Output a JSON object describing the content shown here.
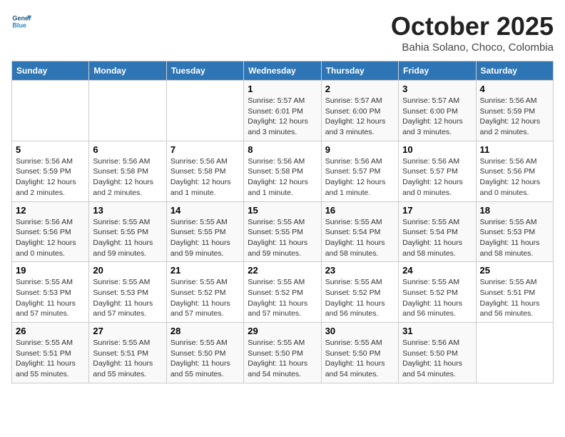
{
  "header": {
    "logo_line1": "General",
    "logo_line2": "Blue",
    "month": "October 2025",
    "location": "Bahia Solano, Choco, Colombia"
  },
  "weekdays": [
    "Sunday",
    "Monday",
    "Tuesday",
    "Wednesday",
    "Thursday",
    "Friday",
    "Saturday"
  ],
  "weeks": [
    [
      {
        "day": "",
        "info": ""
      },
      {
        "day": "",
        "info": ""
      },
      {
        "day": "",
        "info": ""
      },
      {
        "day": "1",
        "info": "Sunrise: 5:57 AM\nSunset: 6:01 PM\nDaylight: 12 hours\nand 3 minutes."
      },
      {
        "day": "2",
        "info": "Sunrise: 5:57 AM\nSunset: 6:00 PM\nDaylight: 12 hours\nand 3 minutes."
      },
      {
        "day": "3",
        "info": "Sunrise: 5:57 AM\nSunset: 6:00 PM\nDaylight: 12 hours\nand 3 minutes."
      },
      {
        "day": "4",
        "info": "Sunrise: 5:56 AM\nSunset: 5:59 PM\nDaylight: 12 hours\nand 2 minutes."
      }
    ],
    [
      {
        "day": "5",
        "info": "Sunrise: 5:56 AM\nSunset: 5:59 PM\nDaylight: 12 hours\nand 2 minutes."
      },
      {
        "day": "6",
        "info": "Sunrise: 5:56 AM\nSunset: 5:58 PM\nDaylight: 12 hours\nand 2 minutes."
      },
      {
        "day": "7",
        "info": "Sunrise: 5:56 AM\nSunset: 5:58 PM\nDaylight: 12 hours\nand 1 minute."
      },
      {
        "day": "8",
        "info": "Sunrise: 5:56 AM\nSunset: 5:58 PM\nDaylight: 12 hours\nand 1 minute."
      },
      {
        "day": "9",
        "info": "Sunrise: 5:56 AM\nSunset: 5:57 PM\nDaylight: 12 hours\nand 1 minute."
      },
      {
        "day": "10",
        "info": "Sunrise: 5:56 AM\nSunset: 5:57 PM\nDaylight: 12 hours\nand 0 minutes."
      },
      {
        "day": "11",
        "info": "Sunrise: 5:56 AM\nSunset: 5:56 PM\nDaylight: 12 hours\nand 0 minutes."
      }
    ],
    [
      {
        "day": "12",
        "info": "Sunrise: 5:56 AM\nSunset: 5:56 PM\nDaylight: 12 hours\nand 0 minutes."
      },
      {
        "day": "13",
        "info": "Sunrise: 5:55 AM\nSunset: 5:55 PM\nDaylight: 11 hours\nand 59 minutes."
      },
      {
        "day": "14",
        "info": "Sunrise: 5:55 AM\nSunset: 5:55 PM\nDaylight: 11 hours\nand 59 minutes."
      },
      {
        "day": "15",
        "info": "Sunrise: 5:55 AM\nSunset: 5:55 PM\nDaylight: 11 hours\nand 59 minutes."
      },
      {
        "day": "16",
        "info": "Sunrise: 5:55 AM\nSunset: 5:54 PM\nDaylight: 11 hours\nand 58 minutes."
      },
      {
        "day": "17",
        "info": "Sunrise: 5:55 AM\nSunset: 5:54 PM\nDaylight: 11 hours\nand 58 minutes."
      },
      {
        "day": "18",
        "info": "Sunrise: 5:55 AM\nSunset: 5:53 PM\nDaylight: 11 hours\nand 58 minutes."
      }
    ],
    [
      {
        "day": "19",
        "info": "Sunrise: 5:55 AM\nSunset: 5:53 PM\nDaylight: 11 hours\nand 57 minutes."
      },
      {
        "day": "20",
        "info": "Sunrise: 5:55 AM\nSunset: 5:53 PM\nDaylight: 11 hours\nand 57 minutes."
      },
      {
        "day": "21",
        "info": "Sunrise: 5:55 AM\nSunset: 5:52 PM\nDaylight: 11 hours\nand 57 minutes."
      },
      {
        "day": "22",
        "info": "Sunrise: 5:55 AM\nSunset: 5:52 PM\nDaylight: 11 hours\nand 57 minutes."
      },
      {
        "day": "23",
        "info": "Sunrise: 5:55 AM\nSunset: 5:52 PM\nDaylight: 11 hours\nand 56 minutes."
      },
      {
        "day": "24",
        "info": "Sunrise: 5:55 AM\nSunset: 5:52 PM\nDaylight: 11 hours\nand 56 minutes."
      },
      {
        "day": "25",
        "info": "Sunrise: 5:55 AM\nSunset: 5:51 PM\nDaylight: 11 hours\nand 56 minutes."
      }
    ],
    [
      {
        "day": "26",
        "info": "Sunrise: 5:55 AM\nSunset: 5:51 PM\nDaylight: 11 hours\nand 55 minutes."
      },
      {
        "day": "27",
        "info": "Sunrise: 5:55 AM\nSunset: 5:51 PM\nDaylight: 11 hours\nand 55 minutes."
      },
      {
        "day": "28",
        "info": "Sunrise: 5:55 AM\nSunset: 5:50 PM\nDaylight: 11 hours\nand 55 minutes."
      },
      {
        "day": "29",
        "info": "Sunrise: 5:55 AM\nSunset: 5:50 PM\nDaylight: 11 hours\nand 54 minutes."
      },
      {
        "day": "30",
        "info": "Sunrise: 5:55 AM\nSunset: 5:50 PM\nDaylight: 11 hours\nand 54 minutes."
      },
      {
        "day": "31",
        "info": "Sunrise: 5:56 AM\nSunset: 5:50 PM\nDaylight: 11 hours\nand 54 minutes."
      },
      {
        "day": "",
        "info": ""
      }
    ]
  ]
}
